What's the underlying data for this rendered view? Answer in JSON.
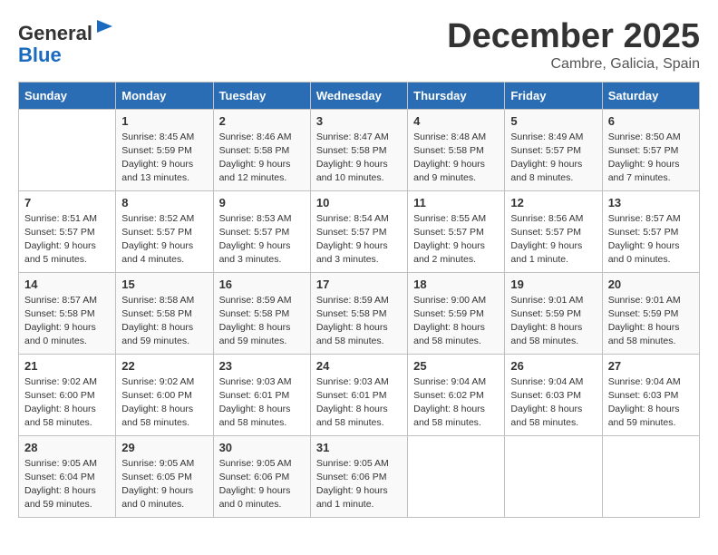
{
  "header": {
    "logo_line1": "General",
    "logo_line2": "Blue",
    "month_title": "December 2025",
    "location": "Cambre, Galicia, Spain"
  },
  "days_of_week": [
    "Sunday",
    "Monday",
    "Tuesday",
    "Wednesday",
    "Thursday",
    "Friday",
    "Saturday"
  ],
  "weeks": [
    [
      {
        "day": "",
        "info": ""
      },
      {
        "day": "1",
        "info": "Sunrise: 8:45 AM\nSunset: 5:59 PM\nDaylight: 9 hours\nand 13 minutes."
      },
      {
        "day": "2",
        "info": "Sunrise: 8:46 AM\nSunset: 5:58 PM\nDaylight: 9 hours\nand 12 minutes."
      },
      {
        "day": "3",
        "info": "Sunrise: 8:47 AM\nSunset: 5:58 PM\nDaylight: 9 hours\nand 10 minutes."
      },
      {
        "day": "4",
        "info": "Sunrise: 8:48 AM\nSunset: 5:58 PM\nDaylight: 9 hours\nand 9 minutes."
      },
      {
        "day": "5",
        "info": "Sunrise: 8:49 AM\nSunset: 5:57 PM\nDaylight: 9 hours\nand 8 minutes."
      },
      {
        "day": "6",
        "info": "Sunrise: 8:50 AM\nSunset: 5:57 PM\nDaylight: 9 hours\nand 7 minutes."
      }
    ],
    [
      {
        "day": "7",
        "info": "Sunrise: 8:51 AM\nSunset: 5:57 PM\nDaylight: 9 hours\nand 5 minutes."
      },
      {
        "day": "8",
        "info": "Sunrise: 8:52 AM\nSunset: 5:57 PM\nDaylight: 9 hours\nand 4 minutes."
      },
      {
        "day": "9",
        "info": "Sunrise: 8:53 AM\nSunset: 5:57 PM\nDaylight: 9 hours\nand 3 minutes."
      },
      {
        "day": "10",
        "info": "Sunrise: 8:54 AM\nSunset: 5:57 PM\nDaylight: 9 hours\nand 3 minutes."
      },
      {
        "day": "11",
        "info": "Sunrise: 8:55 AM\nSunset: 5:57 PM\nDaylight: 9 hours\nand 2 minutes."
      },
      {
        "day": "12",
        "info": "Sunrise: 8:56 AM\nSunset: 5:57 PM\nDaylight: 9 hours\nand 1 minute."
      },
      {
        "day": "13",
        "info": "Sunrise: 8:57 AM\nSunset: 5:57 PM\nDaylight: 9 hours\nand 0 minutes."
      }
    ],
    [
      {
        "day": "14",
        "info": "Sunrise: 8:57 AM\nSunset: 5:58 PM\nDaylight: 9 hours\nand 0 minutes."
      },
      {
        "day": "15",
        "info": "Sunrise: 8:58 AM\nSunset: 5:58 PM\nDaylight: 8 hours\nand 59 minutes."
      },
      {
        "day": "16",
        "info": "Sunrise: 8:59 AM\nSunset: 5:58 PM\nDaylight: 8 hours\nand 59 minutes."
      },
      {
        "day": "17",
        "info": "Sunrise: 8:59 AM\nSunset: 5:58 PM\nDaylight: 8 hours\nand 58 minutes."
      },
      {
        "day": "18",
        "info": "Sunrise: 9:00 AM\nSunset: 5:59 PM\nDaylight: 8 hours\nand 58 minutes."
      },
      {
        "day": "19",
        "info": "Sunrise: 9:01 AM\nSunset: 5:59 PM\nDaylight: 8 hours\nand 58 minutes."
      },
      {
        "day": "20",
        "info": "Sunrise: 9:01 AM\nSunset: 5:59 PM\nDaylight: 8 hours\nand 58 minutes."
      }
    ],
    [
      {
        "day": "21",
        "info": "Sunrise: 9:02 AM\nSunset: 6:00 PM\nDaylight: 8 hours\nand 58 minutes."
      },
      {
        "day": "22",
        "info": "Sunrise: 9:02 AM\nSunset: 6:00 PM\nDaylight: 8 hours\nand 58 minutes."
      },
      {
        "day": "23",
        "info": "Sunrise: 9:03 AM\nSunset: 6:01 PM\nDaylight: 8 hours\nand 58 minutes."
      },
      {
        "day": "24",
        "info": "Sunrise: 9:03 AM\nSunset: 6:01 PM\nDaylight: 8 hours\nand 58 minutes."
      },
      {
        "day": "25",
        "info": "Sunrise: 9:04 AM\nSunset: 6:02 PM\nDaylight: 8 hours\nand 58 minutes."
      },
      {
        "day": "26",
        "info": "Sunrise: 9:04 AM\nSunset: 6:03 PM\nDaylight: 8 hours\nand 58 minutes."
      },
      {
        "day": "27",
        "info": "Sunrise: 9:04 AM\nSunset: 6:03 PM\nDaylight: 8 hours\nand 59 minutes."
      }
    ],
    [
      {
        "day": "28",
        "info": "Sunrise: 9:05 AM\nSunset: 6:04 PM\nDaylight: 8 hours\nand 59 minutes."
      },
      {
        "day": "29",
        "info": "Sunrise: 9:05 AM\nSunset: 6:05 PM\nDaylight: 9 hours\nand 0 minutes."
      },
      {
        "day": "30",
        "info": "Sunrise: 9:05 AM\nSunset: 6:06 PM\nDaylight: 9 hours\nand 0 minutes."
      },
      {
        "day": "31",
        "info": "Sunrise: 9:05 AM\nSunset: 6:06 PM\nDaylight: 9 hours\nand 1 minute."
      },
      {
        "day": "",
        "info": ""
      },
      {
        "day": "",
        "info": ""
      },
      {
        "day": "",
        "info": ""
      }
    ]
  ]
}
